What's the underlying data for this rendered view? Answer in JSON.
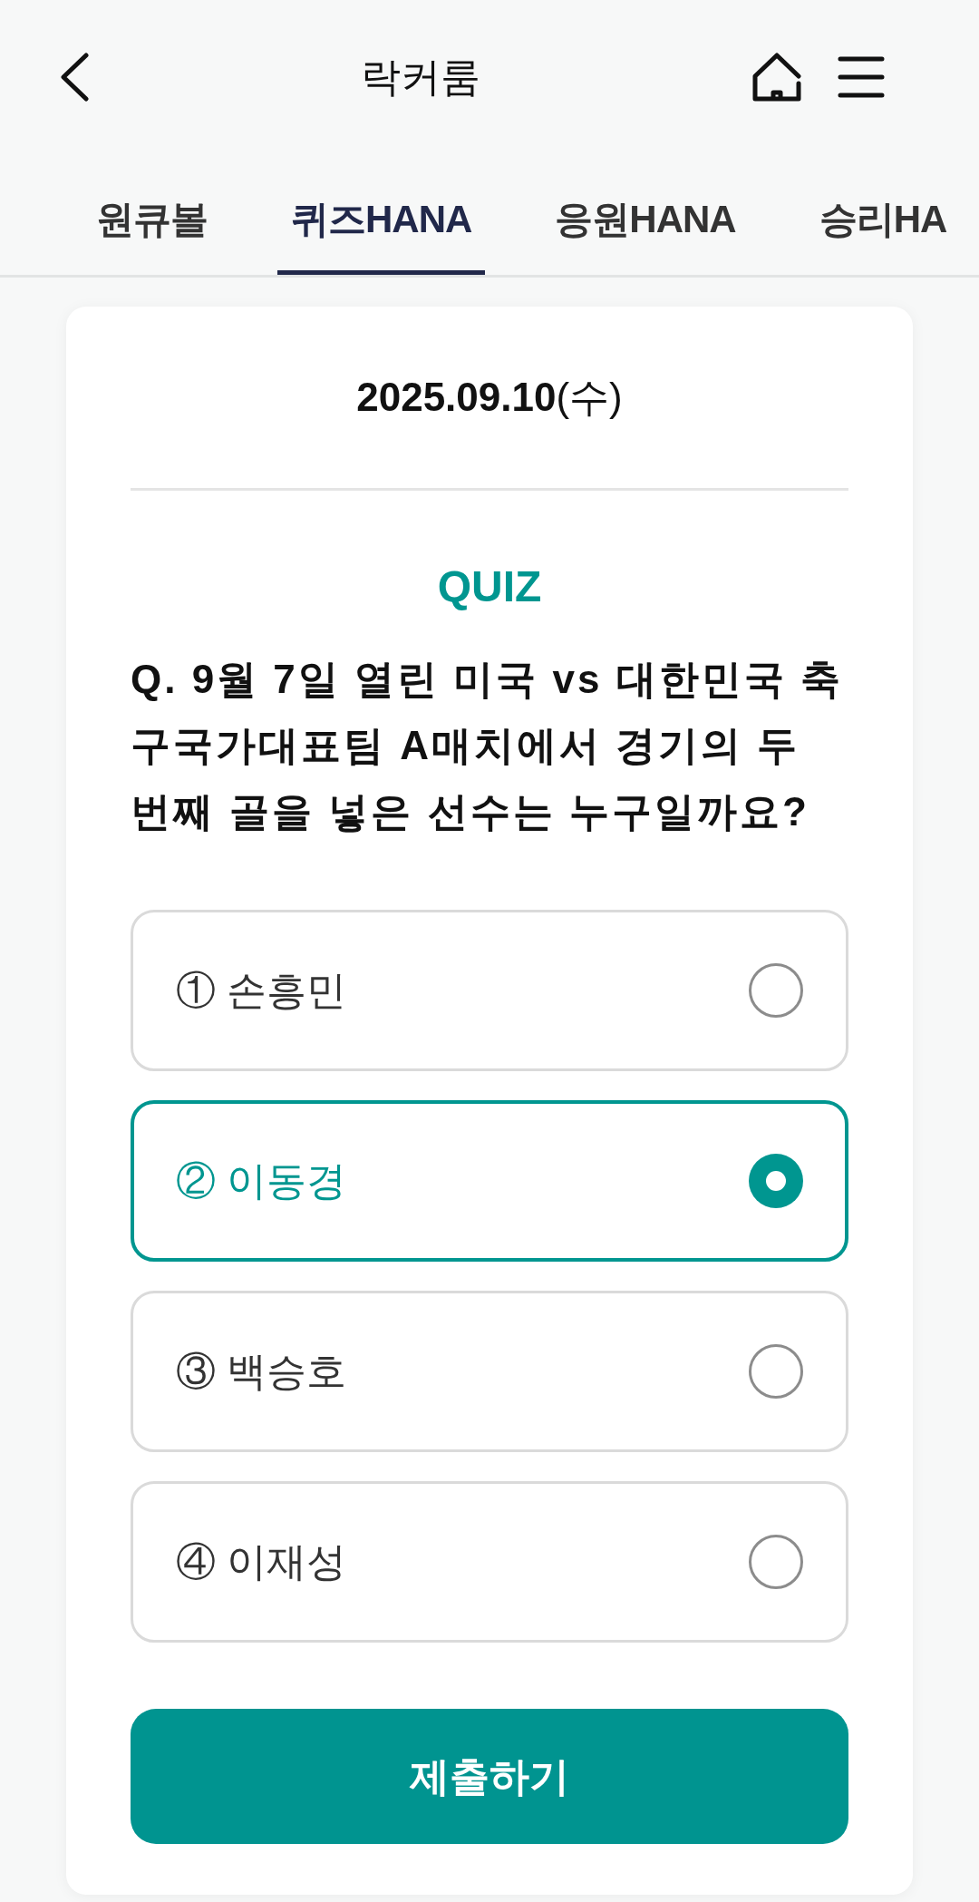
{
  "header": {
    "title": "락커룸"
  },
  "tabs": [
    {
      "label": "원큐볼",
      "selected": false
    },
    {
      "label": "퀴즈HANA",
      "selected": true
    },
    {
      "label": "응원HANA",
      "selected": false
    },
    {
      "label": "승리HA",
      "selected": false
    }
  ],
  "quiz": {
    "date": "**2025.09.10**(수)",
    "heading": "QUIZ",
    "question": "Q. 9월 7일 열린 미국 vs 대한민국 축구국가대표팀 A매치에서 경기의 두 번째 골을 넣은 선수는 누구일까요?",
    "options": [
      {
        "label": "① 손흥민",
        "selected": false
      },
      {
        "label": "② 이동경",
        "selected": true
      },
      {
        "label": "③ 백승호",
        "selected": false
      },
      {
        "label": "④ 이재성",
        "selected": false
      }
    ],
    "submit_button": "제출하기"
  }
}
